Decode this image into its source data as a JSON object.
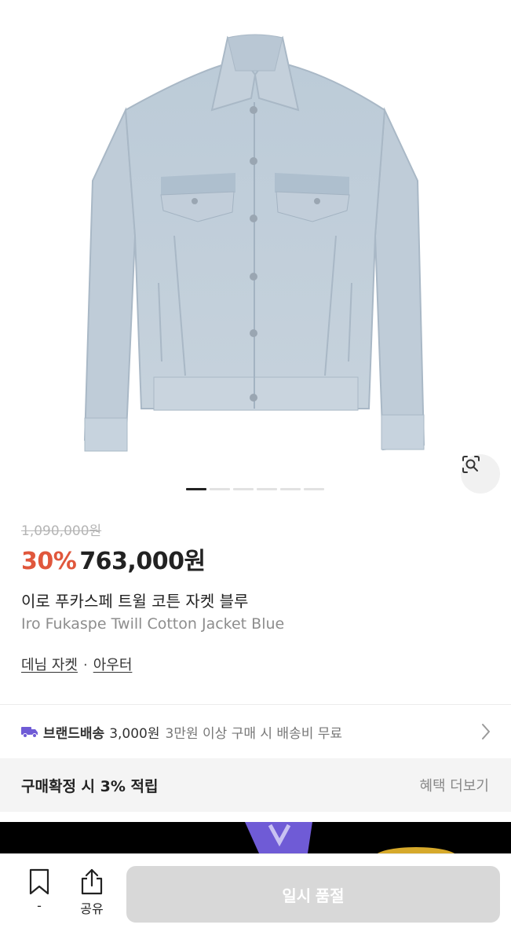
{
  "product": {
    "original_price": "1,090,000원",
    "discount": "30%",
    "price": "763,000원",
    "name_ko": "이로 푸카스페 트윌 코튼 자켓 블루",
    "name_en": "Iro Fukaspe Twill Cotton Jacket Blue",
    "category": [
      "데님 자켓",
      "아우터"
    ],
    "category_separator": "·"
  },
  "gallery": {
    "current_index": 1,
    "total": 6,
    "lens_icon": "lens-search-icon"
  },
  "shipping": {
    "icon": "truck-icon",
    "brand_label": "브랜드배송",
    "fee": "3,000원",
    "note": "3만원 이상 구매 시 배송비 무료"
  },
  "benefit": {
    "title": "구매확정 시 3% 적립",
    "more": "혜택 더보기"
  },
  "bottom_bar": {
    "bookmark_label": "-",
    "share_label": "공유",
    "buy_button": "일시 품절"
  },
  "colors": {
    "discount": "#e0573c",
    "accent_purple": "#6f5bd6",
    "button_disabled": "#d8d8d8"
  }
}
